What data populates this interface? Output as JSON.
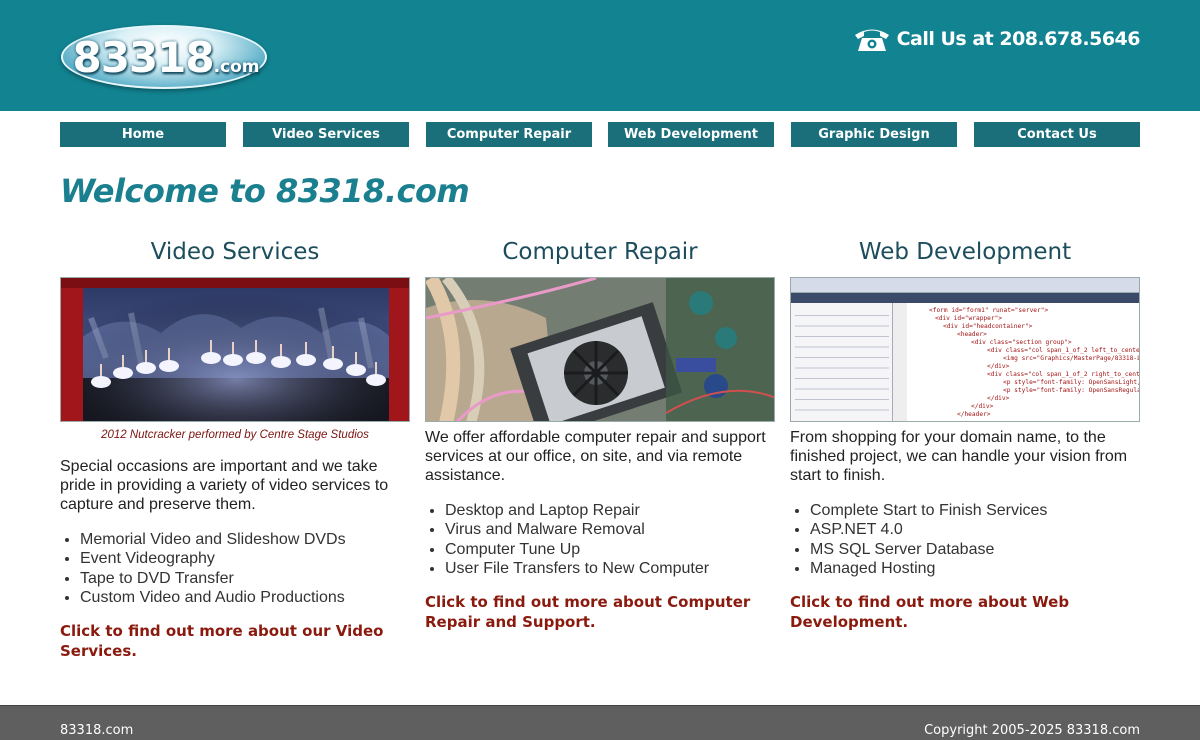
{
  "header": {
    "logo_main": "83318",
    "logo_suffix": ".com",
    "phone_text": "Call Us at 208.678.5646",
    "phone_icon": "telephone-icon",
    "background_color": "#128391"
  },
  "nav": {
    "items": [
      {
        "label": "Home"
      },
      {
        "label": "Video Services"
      },
      {
        "label": "Computer Repair"
      },
      {
        "label": "Web Development"
      },
      {
        "label": "Graphic Design"
      },
      {
        "label": "Contact Us"
      }
    ],
    "background_color": "#1a6f7a"
  },
  "main": {
    "welcome": "Welcome to 83318.com",
    "columns": [
      {
        "title": "Video Services",
        "image": "ballet-stage-photo",
        "caption": "2012 Nutcracker performed by Centre Stage Studios",
        "description": "Special occasions are important and we take pride in providing a variety of video services to capture and preserve them.",
        "items": [
          "Memorial Video and Slideshow DVDs",
          "Event Videography",
          "Tape to DVD Transfer",
          "Custom Video and Audio Productions"
        ],
        "link": "Click to find out more about our Video Services."
      },
      {
        "title": "Computer Repair",
        "image": "computer-internals-photo",
        "caption": "",
        "description": "We offer affordable computer repair and support services at our office, on site, and via remote assistance.",
        "items": [
          "Desktop and Laptop Repair",
          "Virus and Malware Removal",
          "Computer Tune Up",
          "User File Transfers to New Computer"
        ],
        "link": "Click to find out more about Computer Repair and Support."
      },
      {
        "title": "Web Development",
        "image": "code-editor-screenshot",
        "caption": "",
        "description": "From shopping for your domain name, to the finished project, we can handle your vision from start to finish.",
        "items": [
          "Complete Start to Finish Services",
          "ASP.NET 4.0",
          "MS SQL Server Database",
          "Managed Hosting"
        ],
        "link": "Click to find out more about Web Development."
      }
    ]
  },
  "footer": {
    "left": "83318.com",
    "right": "Copyright 2005-2025 83318.com",
    "background_color": "#5f5f5f"
  },
  "colors": {
    "accent": "#1a7f8e",
    "link": "#8b1a0e"
  }
}
